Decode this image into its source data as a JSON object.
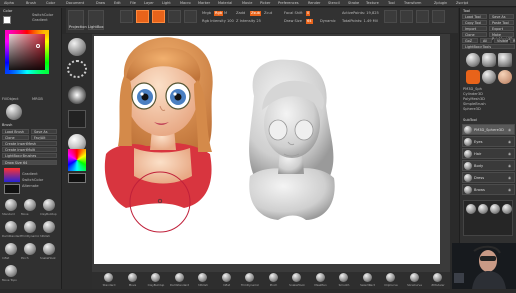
{
  "app": {
    "menu_items": [
      "Alpha",
      "Brush",
      "Color",
      "Document",
      "Draw",
      "Edit",
      "File",
      "Layer",
      "Light",
      "Macro",
      "Marker",
      "Material",
      "Movie",
      "Picker",
      "Preferences",
      "Render",
      "Stencil",
      "Stroke",
      "Texture",
      "Tool",
      "Transform",
      "Zplugin",
      "Zscript"
    ]
  },
  "toolshelf": {
    "lightbox_label": "LightBox",
    "projection_label": "Projection Master",
    "mrgb_label": "Mrgb",
    "rgb_label": "Rgb",
    "m_label": "M",
    "zadd_label": "Zadd",
    "zsub_label": "Zsub",
    "zcut_label": "Zcut",
    "focal_shift_label": "Focal Shift",
    "focal_shift_value": "0",
    "draw_size_label": "Draw Size",
    "draw_size_value": "64",
    "dynamic_label": "Dynamic",
    "active_points_label": "ActivePoints: 19,825",
    "total_points_label": "TotalPoints: 1.49 Mil",
    "rgb_intensity_label": "Rgb Intensity 100",
    "z_intensity_label": "Z Intensity 25"
  },
  "left_panel": {
    "title": "Color",
    "switch_color_label": "SwitchColor",
    "gradient_label": "Gradient",
    "fill_object_label": "FillObject",
    "mrgb_label": "MRGB",
    "brush_section_title": "Brush",
    "brush_buttons": [
      "Load Brush",
      "Save As",
      "Clone",
      "Fav/Alt",
      "Create InsertMesh",
      "Create InsertMulti",
      "LightBox>Brushes"
    ],
    "draw_size_row": "Draw Size 64",
    "gradient2_label": "Gradient",
    "switch_color2_label": "SwitchColor",
    "alternate_label": "Alternate",
    "brushes": [
      "Standard",
      "Move",
      "ClayBuildup",
      "DamStandard",
      "TrimDynamic",
      "hPolish",
      "Inflat",
      "Pinch",
      "SnakeHook",
      "Move Topo"
    ]
  },
  "right_panel": {
    "title": "Tool",
    "buttons": [
      "Load Tool",
      "Save As",
      "Copy Tool",
      "Paste Tool",
      "Import",
      "Export",
      "Clone",
      "Make PolyMesh3D",
      "GoZ",
      "All",
      "Visible",
      "R",
      "LightBox>Tools"
    ],
    "subtool_title": "SubTool",
    "subtool_items": [
      "PM3D_Sphere3D",
      "Eyes",
      "Hair",
      "Body",
      "Dress",
      "Brows"
    ],
    "tool_names": [
      "PM3D_Sph",
      "Cylinder3D",
      "PolyMesh3D",
      "SimpleBrush",
      "Sphere3D"
    ]
  },
  "bottom_shelf": {
    "items": [
      "Standard",
      "Move",
      "ClayBuildup",
      "DamStandard",
      "hPolish",
      "Inflat",
      "TrimDynamic",
      "Pinch",
      "SnakeHook",
      "MaskPen",
      "Smooth",
      "SelectRect",
      "ClipCurve",
      "SliceCurve",
      "ZModeler"
    ]
  },
  "colors": {
    "accent": "#e8631a",
    "skin": "#f3c9a6",
    "hair": "#d98a47",
    "dress": "#d8353f",
    "eye": "#4a7fc1",
    "brush_ring": "#c0203a"
  }
}
